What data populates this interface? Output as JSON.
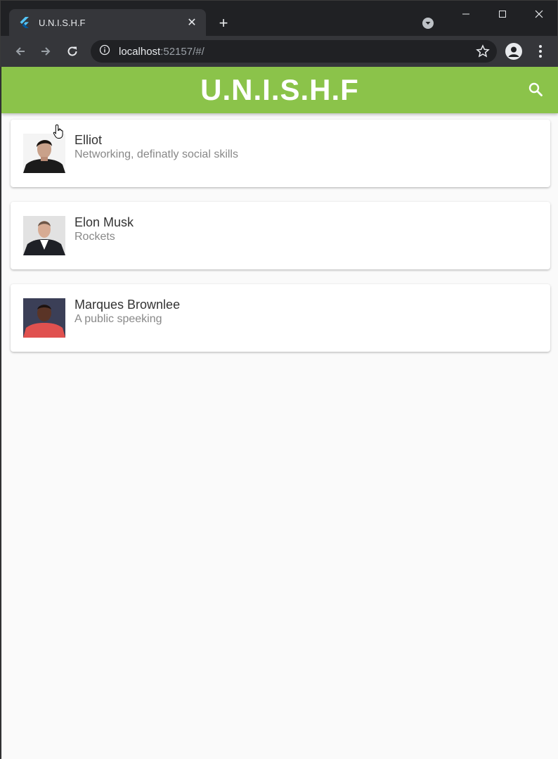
{
  "browser": {
    "tab_title": "U.N.I.S.H.F",
    "tab_close": "✕",
    "new_tab": "+",
    "url_host": "localhost",
    "url_rest": ":52157/#/"
  },
  "app": {
    "title": "U.N.I.S.H.F",
    "accent_color": "#8bc34a"
  },
  "people": [
    {
      "name": "Elliot",
      "skill": "Networking, definatly social skills"
    },
    {
      "name": "Elon Musk",
      "skill": "Rockets"
    },
    {
      "name": "Marques Brownlee",
      "skill": "A public speeking"
    }
  ]
}
